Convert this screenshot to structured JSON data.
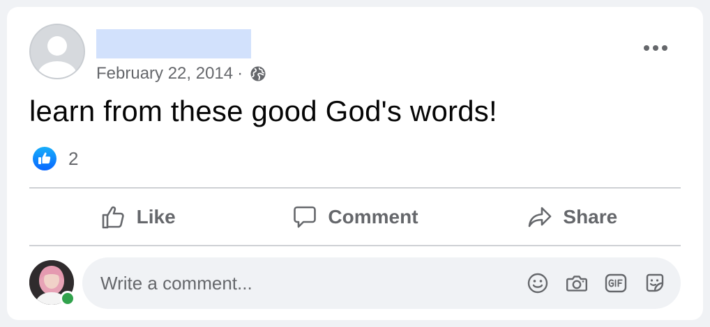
{
  "post": {
    "date": "February 22, 2014",
    "separator": "·",
    "audience_icon": "globe-icon",
    "text": "learn from these good God's words!",
    "reactions": {
      "icon": "like-reaction-icon",
      "count": "2"
    }
  },
  "actions": {
    "like_label": "Like",
    "comment_label": "Comment",
    "share_label": "Share"
  },
  "composer": {
    "placeholder": "Write a comment...",
    "icons": [
      "emoji-icon",
      "camera-icon",
      "gif-icon",
      "sticker-icon"
    ]
  },
  "colors": {
    "accent": "#1877f2",
    "secondary_text": "#65676b",
    "online": "#31a24c",
    "redacted_name": "#d2e1fc"
  }
}
